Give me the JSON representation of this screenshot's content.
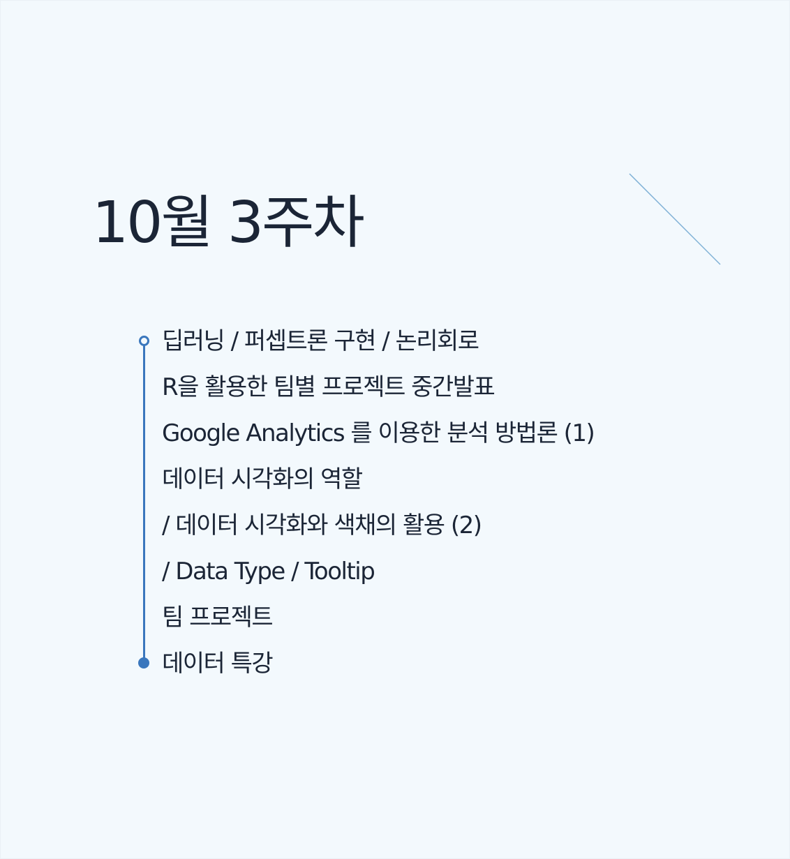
{
  "title": "10월 3주차",
  "accent_color": "#3a77bd",
  "line_color": "#7fb1d6",
  "items": [
    "딥러닝 / 퍼셉트론 구현 / 논리회로",
    "R을 활용한 팀별 프로젝트 중간발표",
    "Google Analytics 를 이용한 분석 방법론 (1)",
    "데이터 시각화의 역할",
    "/ 데이터 시각화와 색채의 활용 (2)",
    "/ Data Type / Tooltip",
    "팀 프로젝트",
    "데이터 특강"
  ]
}
